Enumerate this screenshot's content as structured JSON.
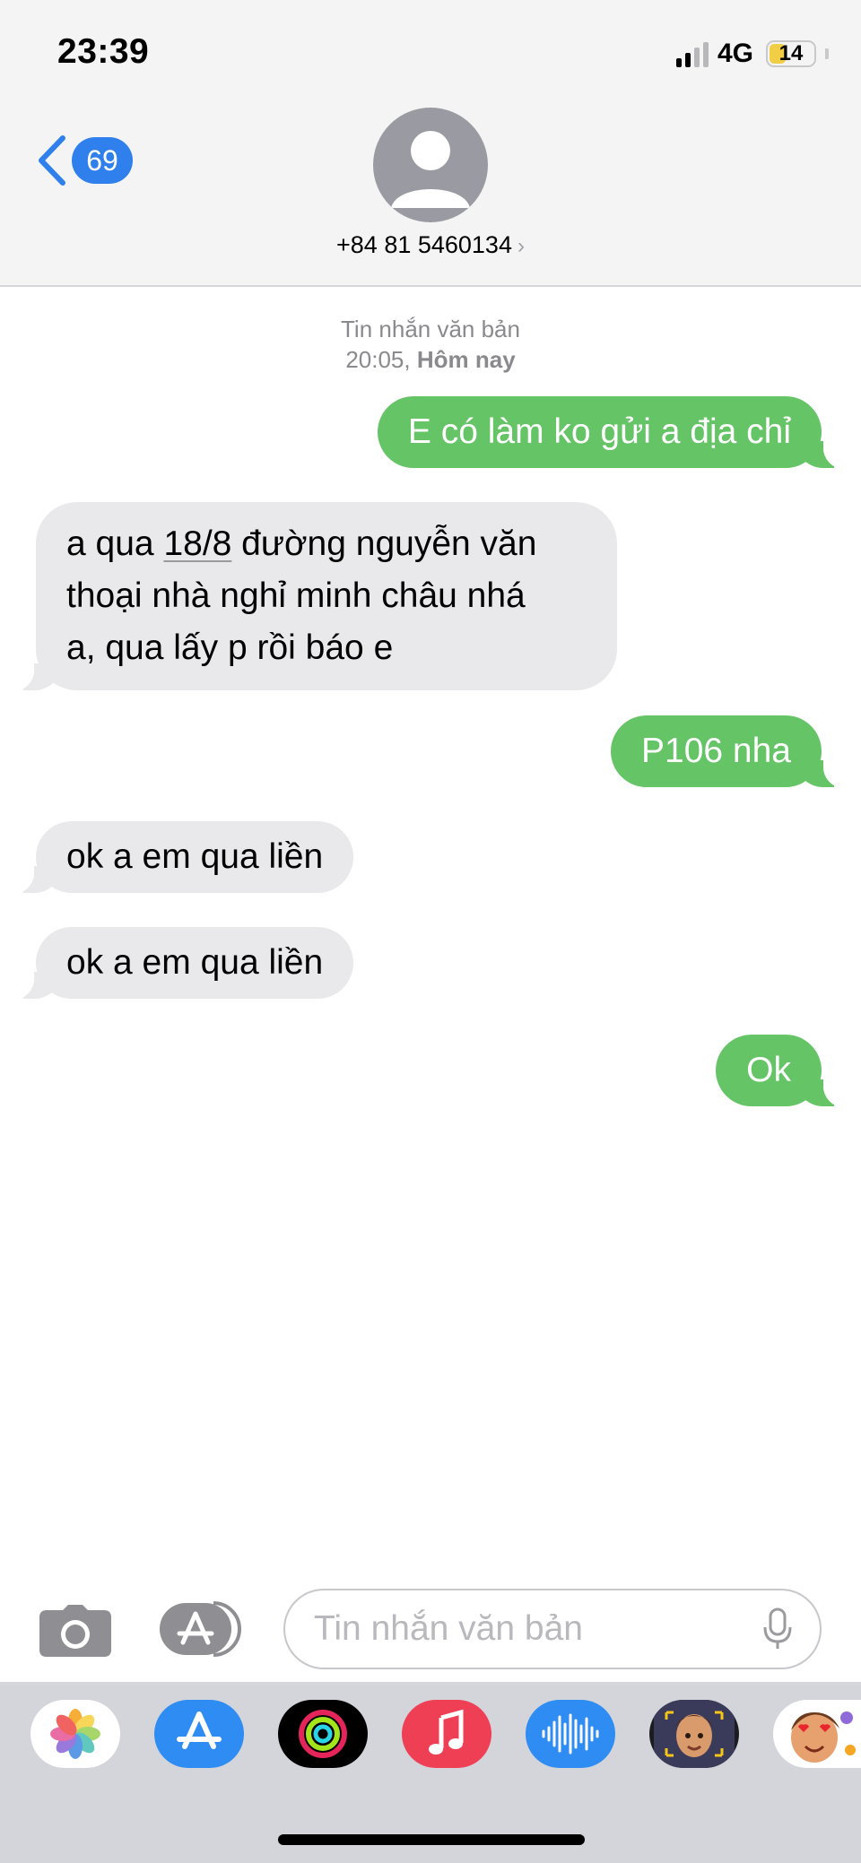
{
  "status_bar": {
    "time": "23:39",
    "network": "4G",
    "battery": "14"
  },
  "header": {
    "back_count": "69",
    "contact": "+84 81 5460134",
    "contact_chevron": "›"
  },
  "conversation": {
    "meta_type": "Tin nhắn văn bản",
    "meta_time": "20:05,",
    "meta_day": "Hôm nay",
    "messages": [
      {
        "dir": "sent",
        "text": "E có làm ko gửi a địa chỉ"
      },
      {
        "dir": "received",
        "line1_pre": "a qua ",
        "line1_date": "18/8",
        "line1_post": " đường nguyễn văn",
        "line2": "thoại nhà nghỉ minh châu nhá",
        "line3": "a, qua lấy p rồi báo e"
      },
      {
        "dir": "sent",
        "text": "P106 nha"
      },
      {
        "dir": "received",
        "text": "ok a em qua liền"
      },
      {
        "dir": "received",
        "text": "ok a em qua liền"
      },
      {
        "dir": "sent",
        "text": "Ok"
      }
    ]
  },
  "composer": {
    "placeholder": "Tin nhắn văn bản"
  },
  "app_drawer": {
    "apps": [
      "photos-icon",
      "app-store-icon",
      "activity-icon",
      "music-icon",
      "voice-memos-icon",
      "memoji-icon",
      "animoji-icon"
    ]
  },
  "colors": {
    "sent_bubble": "#65c466",
    "received_bubble": "#e9e9eb",
    "accent": "#2f80ed"
  }
}
